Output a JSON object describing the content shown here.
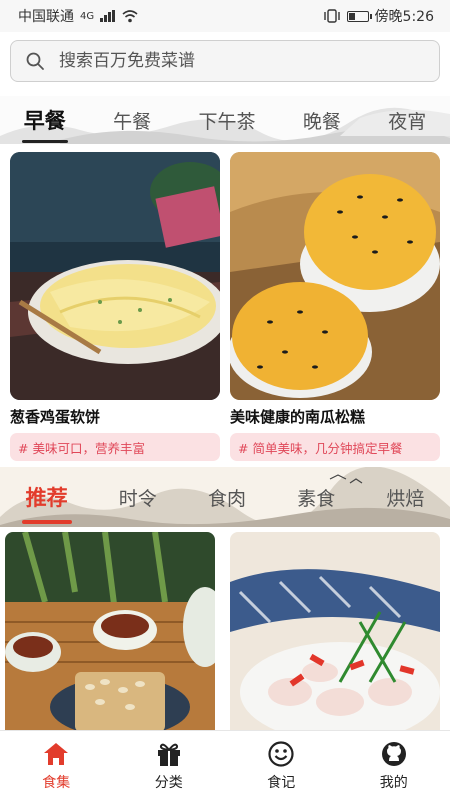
{
  "status_bar": {
    "carrier": "中国联通",
    "network": "4G",
    "time": "傍晚5:26",
    "icons": [
      "signal-icon",
      "wifi-icon",
      "vibrate-icon",
      "battery-icon"
    ]
  },
  "search": {
    "placeholder": "搜索百万免费菜谱"
  },
  "meal_tabs": [
    "早餐",
    "午餐",
    "下午茶",
    "晚餐",
    "夜宵"
  ],
  "meal_tabs_active": "早餐",
  "featured": [
    {
      "title": "葱香鸡蛋软饼",
      "tag": "# 美味可口，营养丰富",
      "image": "scallion-egg-pancake-photo"
    },
    {
      "title": "美味健康的南瓜松糕",
      "tag": "# 简单美味，几分钟搞定早餐",
      "image": "pumpkin-sponge-cake-photo"
    }
  ],
  "category_tabs": [
    "推荐",
    "时令",
    "食肉",
    "素食",
    "烘焙"
  ],
  "category_tabs_active": "推荐",
  "recommend_images": [
    "tea-and-seed-cake-photo",
    "squid-with-peppers-photo"
  ],
  "bottom_nav": [
    {
      "label": "食集",
      "icon": "home-icon",
      "active": true
    },
    {
      "label": "分类",
      "icon": "gift-icon",
      "active": false
    },
    {
      "label": "食记",
      "icon": "smiley-icon",
      "active": false
    },
    {
      "label": "我的",
      "icon": "github-icon",
      "active": false
    }
  ],
  "colors": {
    "accent": "#e23c2c",
    "tag_bg": "#fbe1e3",
    "tag_text": "#e04758"
  }
}
